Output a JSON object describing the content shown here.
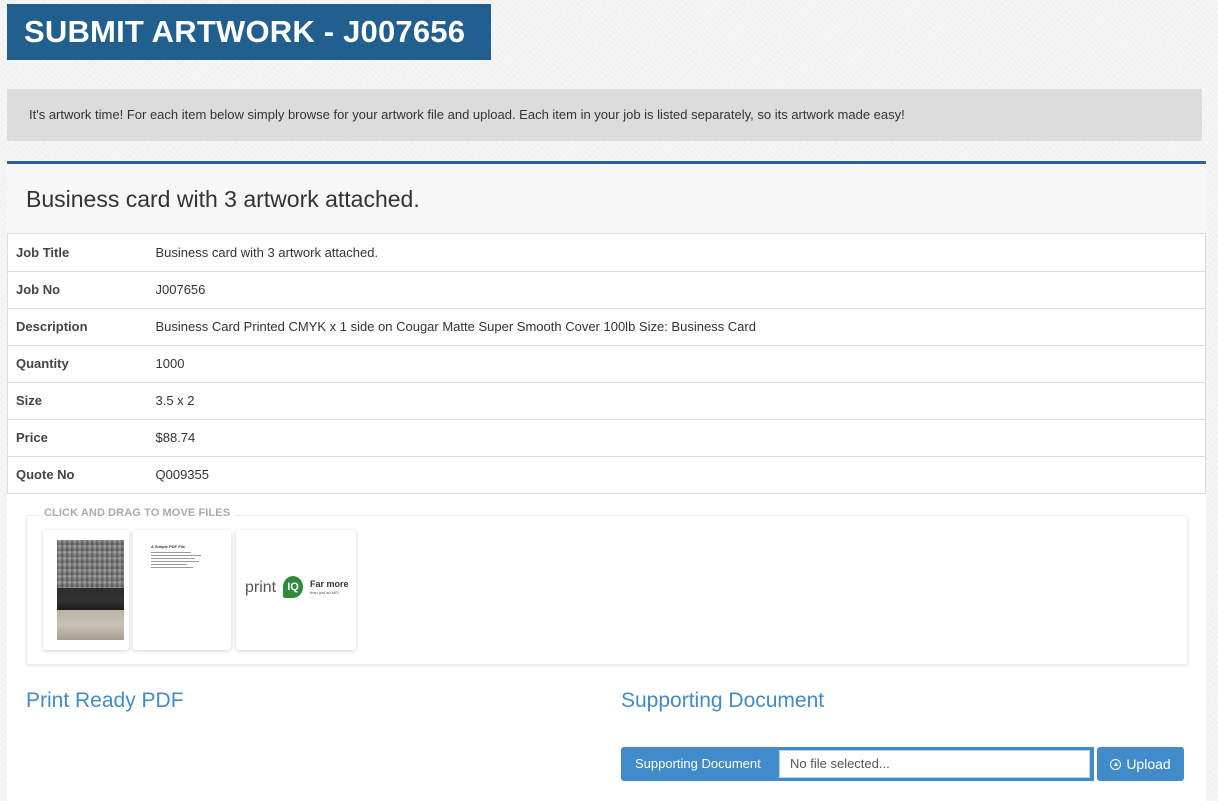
{
  "page": {
    "title": "SUBMIT ARTWORK - J007656",
    "intro": "It's artwork time! For each item below simply browse for your artwork file and upload. Each item in your job is listed separately, so its artwork made easy!"
  },
  "job": {
    "heading": "Business card with 3 artwork attached.",
    "rows": [
      {
        "label": "Job Title",
        "value": "Business card with 3 artwork attached."
      },
      {
        "label": "Job No",
        "value": "J007656"
      },
      {
        "label": "Description",
        "value": "Business Card Printed CMYK x 1 side on Cougar Matte Super Smooth Cover 100lb Size: Business Card"
      },
      {
        "label": "Quantity",
        "value": "1000"
      },
      {
        "label": "Size",
        "value": "3.5 x 2"
      },
      {
        "label": "Price",
        "value": "$88.74"
      },
      {
        "label": "Quote No",
        "value": "Q009355"
      }
    ]
  },
  "files": {
    "drag_label": "CLICK AND DRAG TO MOVE FILES",
    "thumbnails": [
      {
        "kind": "photo"
      },
      {
        "kind": "document",
        "doc_title": "A Simple PDF File"
      },
      {
        "kind": "logo",
        "word": "print",
        "mark": "IQ",
        "tagline": "Far more",
        "tagline_sub": "than just an MIS"
      }
    ]
  },
  "sections": {
    "print_ready": "Print Ready PDF",
    "supporting": "Supporting Document"
  },
  "upload": {
    "label": "Supporting Document",
    "file_placeholder": "No file selected...",
    "button": "Upload"
  },
  "colors": {
    "brand": "#215f8e",
    "accent": "#428bca"
  }
}
